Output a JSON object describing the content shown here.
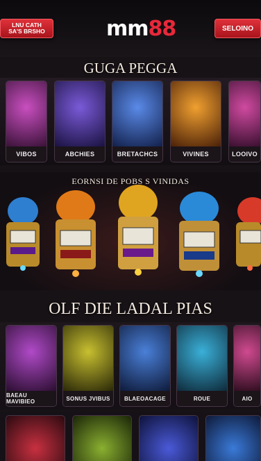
{
  "header": {
    "left_button": "LNU CATH SA'S BRSHO",
    "logo_white": "mm",
    "logo_red": "88",
    "right_button": "SELOINO"
  },
  "sections": {
    "top_title": "GUGA PEGGA",
    "middle_title": "EORNSI DE POBS S VINIDAS",
    "bottom_title": "OLF DIE LADAL PIAS"
  },
  "row1": [
    {
      "label": "VIBOS",
      "color": "#8a2f8c"
    },
    {
      "label": "ABCHIES",
      "color": "#3a2f8c"
    },
    {
      "label": "BRETACHCS",
      "color": "#2d4fa8"
    },
    {
      "label": "VIVINES",
      "color": "#b86a12"
    },
    {
      "label": "LOOIVO",
      "color": "#9a2a7a"
    }
  ],
  "row2": [
    {
      "color": "#2e7fd0"
    },
    {
      "color": "#e07a18"
    },
    {
      "color": "#e0a520"
    },
    {
      "color": "#2a8ad8"
    },
    {
      "color": "#d83a2a"
    }
  ],
  "row3": [
    {
      "label": "BAEAU MAVIBIEO",
      "color": "#7a2a8c"
    },
    {
      "label": "SONUS JVIBUS",
      "color": "#8c8a18"
    },
    {
      "label": "BLAEOACAGE",
      "color": "#2a5aa8"
    },
    {
      "label": "ROUE",
      "color": "#2a8ab0"
    },
    {
      "label": "AIO",
      "color": "#a02a6a"
    }
  ],
  "row4": [
    {
      "color": "#a82030"
    },
    {
      "color": "#5a7a1a"
    },
    {
      "color": "#2a3aa0"
    },
    {
      "color": "#2a5aa0"
    }
  ]
}
